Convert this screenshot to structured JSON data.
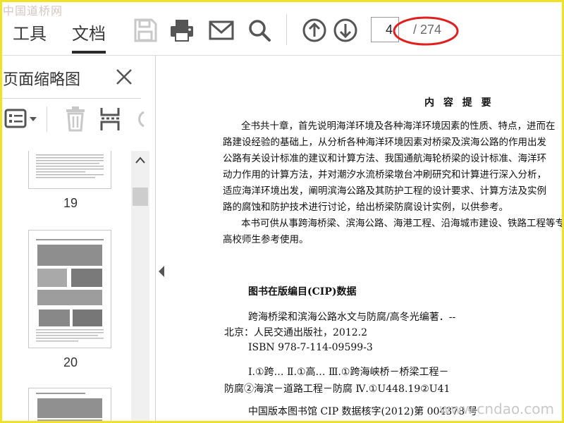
{
  "watermark": {
    "site_name": "中国道桥网",
    "site_url": "www.cndao.com"
  },
  "toolbar": {
    "tabs": [
      {
        "label": "工具"
      },
      {
        "label": "文档"
      }
    ],
    "icons": [
      "save-icon",
      "print-icon",
      "email-icon",
      "search-icon",
      "arrow-up-circle-icon",
      "arrow-down-circle-icon"
    ],
    "page_current": "4",
    "page_total": "/ 274"
  },
  "panel": {
    "title": "页面缩略图",
    "thumbnails": [
      {
        "page": "19"
      },
      {
        "page": "20"
      }
    ]
  },
  "document": {
    "summary_title": "内 容 提 要",
    "summary_lines": [
      "全书共十章，首先说明海洋环境及各种海洋环境因素的性质、特点，进而在",
      "路建设经验的基础上，从分析各种海洋环境因素对桥梁及滨海公路的作用出发",
      "公路有关设计标准的建议和计算方法、我国通航海轮桥梁的设计标准、海洋环",
      "动力作用的计算方法，并对潮汐水流桥梁墩台冲刷研究和计算进行深入分析，",
      "适应海洋环境出发，阐明滨海公路及其防护工程的设计要求、计算方法及实例",
      "路的腐蚀和防护技术进行讨论，给出桥梁防腐设计实例，以供参考。",
      "本书可供从事跨海桥梁、滨海公路、海港工程、沿海城市建设、铁路工程等专",
      "高校师生参考使用。"
    ],
    "cip_title": "图书在版编目(CIP)数据",
    "cip_lines": [
      "跨海桥梁和滨海公路水文与防腐/高冬光编著．--",
      "北京：人民交通出版社，2012.2",
      "ISBN 978-7-114-09599-3",
      "Ⅰ.①跨… Ⅱ.①高… Ⅲ.①跨海峡桥－桥梁工程－",
      "防腐②海滨－道路工程－防腐 Ⅳ.①U448.19②U41",
      "中国版本图书馆 CIP 数据核字(2012)第 004378 号"
    ]
  },
  "colors": {
    "frame": "#f2e227",
    "annotation_circle": "#e02020"
  }
}
